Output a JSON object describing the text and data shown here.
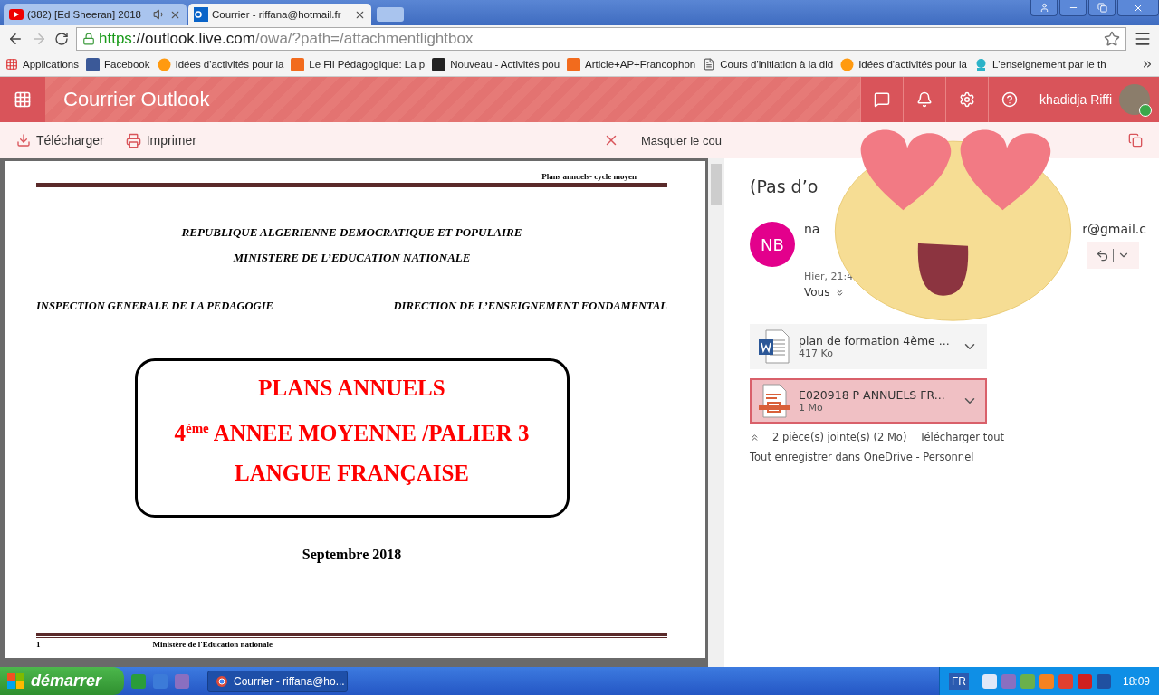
{
  "browser": {
    "tabs": [
      {
        "title": "(382) [Ed Sheeran] 2018",
        "audio": true,
        "selected": false
      },
      {
        "title": "Courrier - riffana@hotmail.fr",
        "audio": false,
        "selected": true
      }
    ],
    "url": {
      "scheme": "https",
      "rest": "://outlook.live.com",
      "path": "/owa/?path=/attachmentlightbox"
    },
    "bookmarks": [
      "Applications",
      "Facebook",
      "Idées d'activités pour la",
      "Le Fil Pédagogique: La p",
      "Nouveau - Activités pou",
      "Article+AP+Francophon",
      "Cours d'initiation à la did",
      "Idées d'activités pour la",
      "L'enseignement par le th"
    ]
  },
  "app": {
    "title": "Courrier Outlook",
    "user": "khadidja Riffi"
  },
  "actions": [
    "Télécharger",
    "Imprimer"
  ],
  "hide_panel": "Masquer le cou",
  "document": {
    "running_head": "Plans annuels- cycle moyen",
    "lines": [
      "REPUBLIQUE ALGERIENNE DEMOCRATIQUE ET POPULAIRE",
      "MINISTERE DE L’EDUCATION NATIONALE"
    ],
    "left_heading": "INSPECTION GENERALE DE LA PEDAGOGIE",
    "right_heading": "DIRECTION DE L’ENSEIGNEMENT FONDAMENTAL",
    "title_lines": [
      "PLANS ANNUELS",
      "4$^{ème}$ ANNEE MOYENNE /PALIER 3",
      "LANGUE FRANÇAISE"
    ],
    "date": "Septembre 2018",
    "page_number": "1",
    "footer": "Ministère de l'Education nationale"
  },
  "message": {
    "subject": "(Pas d’o",
    "initials": "NB",
    "sender_start": "na",
    "sender_end": "r@gmail.c",
    "time": "Hier, 21:4",
    "to": "Vous",
    "attachments": [
      {
        "name": "plan de formation 4ème ...",
        "size": "417 Ko",
        "kind": "word",
        "selected": false
      },
      {
        "name": "E020918 P ANNUELS FR...",
        "size": "1 Mo",
        "kind": "pdf",
        "selected": true
      }
    ],
    "summary": "2 pièce(s) jointe(s) (2 Mo)",
    "download_all": "Télécharger tout",
    "save_all": "Tout enregistrer dans OneDrive - Personnel"
  },
  "taskbar": {
    "start": "démarrer",
    "window": "Courrier - riffana@ho...",
    "language": "FR",
    "clock": "18:09"
  }
}
